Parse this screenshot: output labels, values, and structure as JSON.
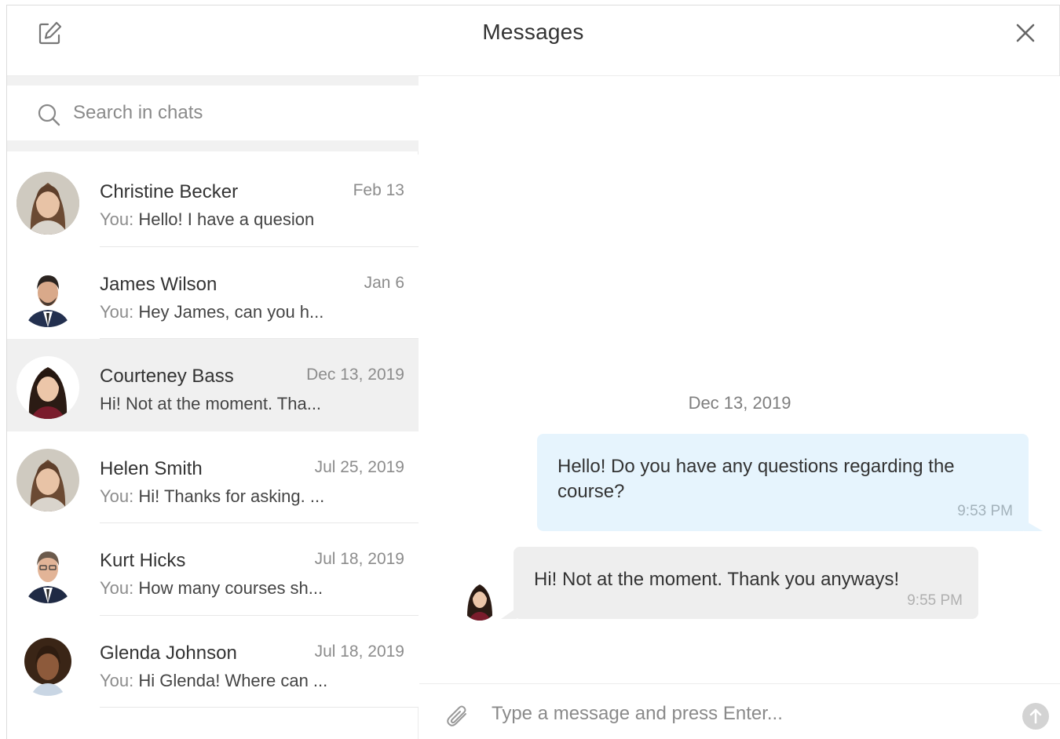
{
  "header": {
    "title": "Messages",
    "compose_icon": "compose-icon",
    "close_icon": "close-icon"
  },
  "search": {
    "placeholder": "Search in chats",
    "icon": "search-icon"
  },
  "chats": [
    {
      "name": "Christine Becker",
      "date": "Feb 13",
      "you": "You:",
      "preview": "Hello! I have a quesion",
      "avatar": "woman-light-hair"
    },
    {
      "name": "James Wilson",
      "date": "Jan 6",
      "you": "You:",
      "preview": "Hey James, can you h...",
      "avatar": "man-suit"
    },
    {
      "name": "Courteney Bass",
      "date": "Dec 13, 2019",
      "you": "",
      "preview": "Hi! Not at the moment. Tha...",
      "avatar": "woman-dark-hair",
      "selected": true
    },
    {
      "name": "Helen Smith",
      "date": "Jul 25, 2019",
      "you": "You:",
      "preview": "Hi! Thanks for asking. ...",
      "avatar": "woman-light-hair"
    },
    {
      "name": "Kurt Hicks",
      "date": "Jul 18, 2019",
      "you": "You:",
      "preview": "How many courses sh...",
      "avatar": "man-glasses"
    },
    {
      "name": "Glenda Johnson",
      "date": "Jul 18, 2019",
      "you": "You:",
      "preview": "Hi Glenda! Where can ...",
      "avatar": "woman-curly-hair"
    }
  ],
  "conversation": {
    "date_separator": "Dec 13, 2019",
    "messages": [
      {
        "direction": "outgoing",
        "text": "Hello! Do you have any questions regarding the course?",
        "time": "9:53 PM"
      },
      {
        "direction": "incoming",
        "text": "Hi! Not at the moment. Thank you anyways!",
        "time": "9:55 PM"
      }
    ]
  },
  "composer": {
    "placeholder": "Type a message and press Enter...",
    "attach_icon": "paperclip-icon",
    "send_icon": "send-arrow-icon"
  },
  "colors": {
    "outgoing_bubble": "#e6f4fd",
    "incoming_bubble": "#eeeeee",
    "selected_row": "#f0f0f0",
    "send_button": "#d3d3d3"
  }
}
